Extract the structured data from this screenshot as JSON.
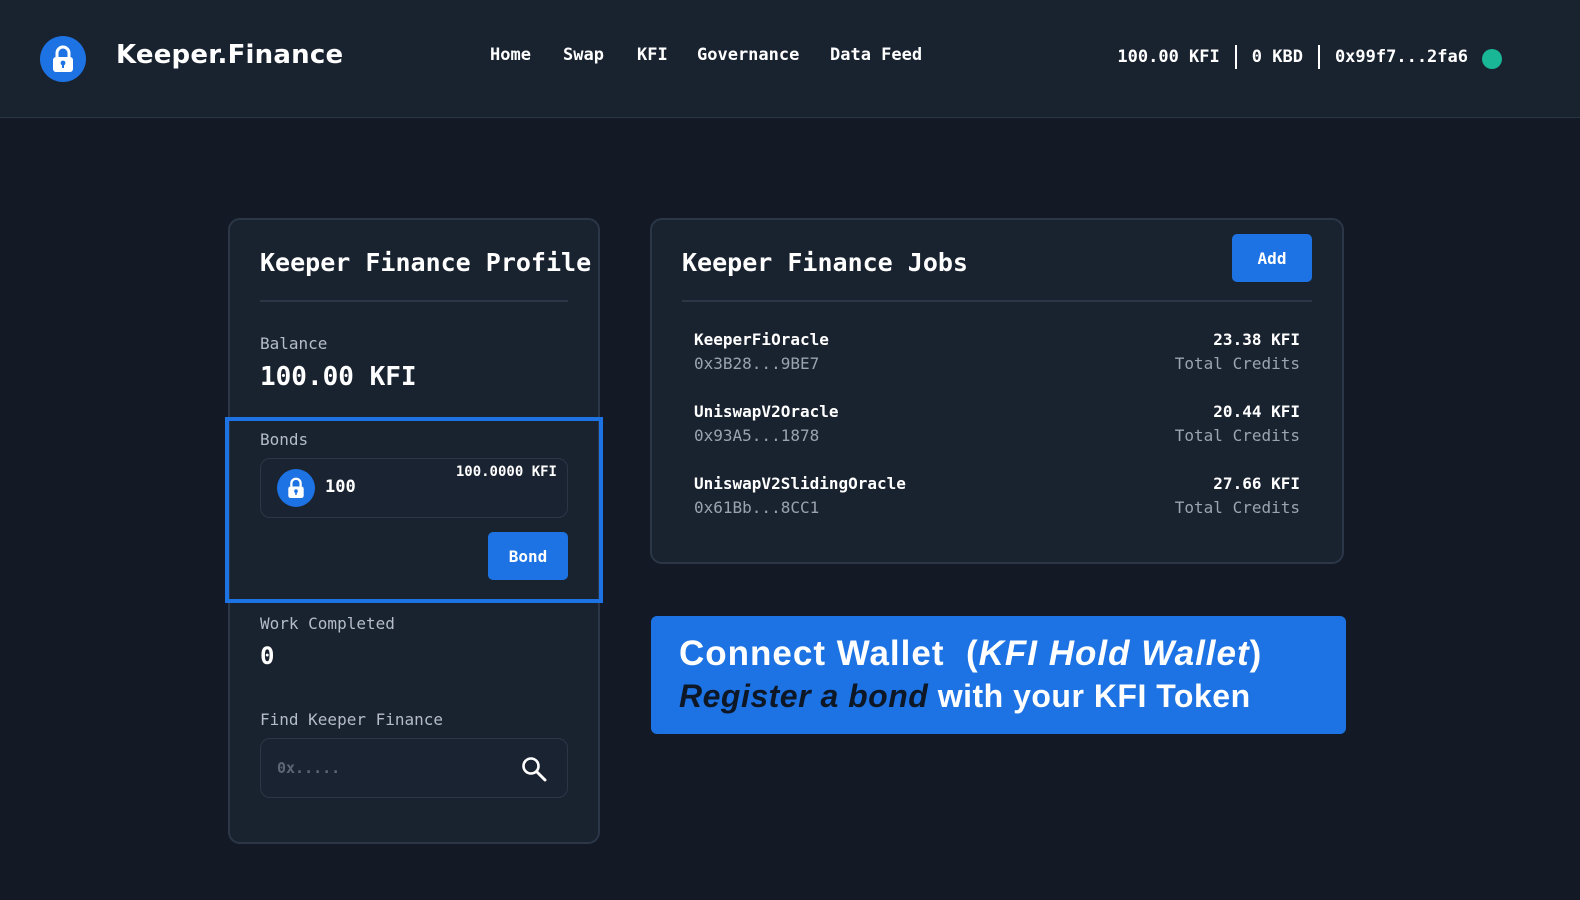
{
  "header": {
    "brand": "Keeper.Finance",
    "nav": [
      "Home",
      "Swap",
      "KFI",
      "Governance",
      "Data Feed"
    ],
    "kfi_balance": "100.00 KFI",
    "kbd_balance": "0 KBD",
    "address": "0x99f7...2fa6",
    "status_color": "#19b795"
  },
  "profile": {
    "title": "Keeper Finance Profile",
    "balance_label": "Balance",
    "balance_value": "100.00 KFI",
    "bonds_label": "Bonds",
    "bond_amount": "100",
    "bond_kfi": "100.0000 KFI",
    "bond_button": "Bond",
    "work_label": "Work Completed",
    "work_value": "0",
    "find_label": "Find Keeper Finance",
    "search_placeholder": "0x....."
  },
  "jobs": {
    "title": "Keeper Finance Jobs",
    "add_button": "Add",
    "items": [
      {
        "name": "KeeperFiOracle",
        "address": "0x3B28...9BE7",
        "credits": "23.38 KFI",
        "credits_label": "Total Credits"
      },
      {
        "name": "UniswapV2Oracle",
        "address": "0x93A5...1878",
        "credits": "20.44 KFI",
        "credits_label": "Total Credits"
      },
      {
        "name": "UniswapV2SlidingOracle",
        "address": "0x61Bb...8CC1",
        "credits": "27.66 KFI",
        "credits_label": "Total Credits"
      }
    ]
  },
  "banner": {
    "line1_a": "Connect Wallet",
    "line1_b": "(",
    "line1_c": "KFI Hold Wallet",
    "line1_d": ")",
    "line2_emph": "Register a bond",
    "line2_rest": " with your KFI Token"
  },
  "colors": {
    "accent": "#1d73e3",
    "background": "#131a26",
    "card": "#19222f"
  },
  "icons": {
    "logo": "lock-icon",
    "search": "search-icon"
  }
}
